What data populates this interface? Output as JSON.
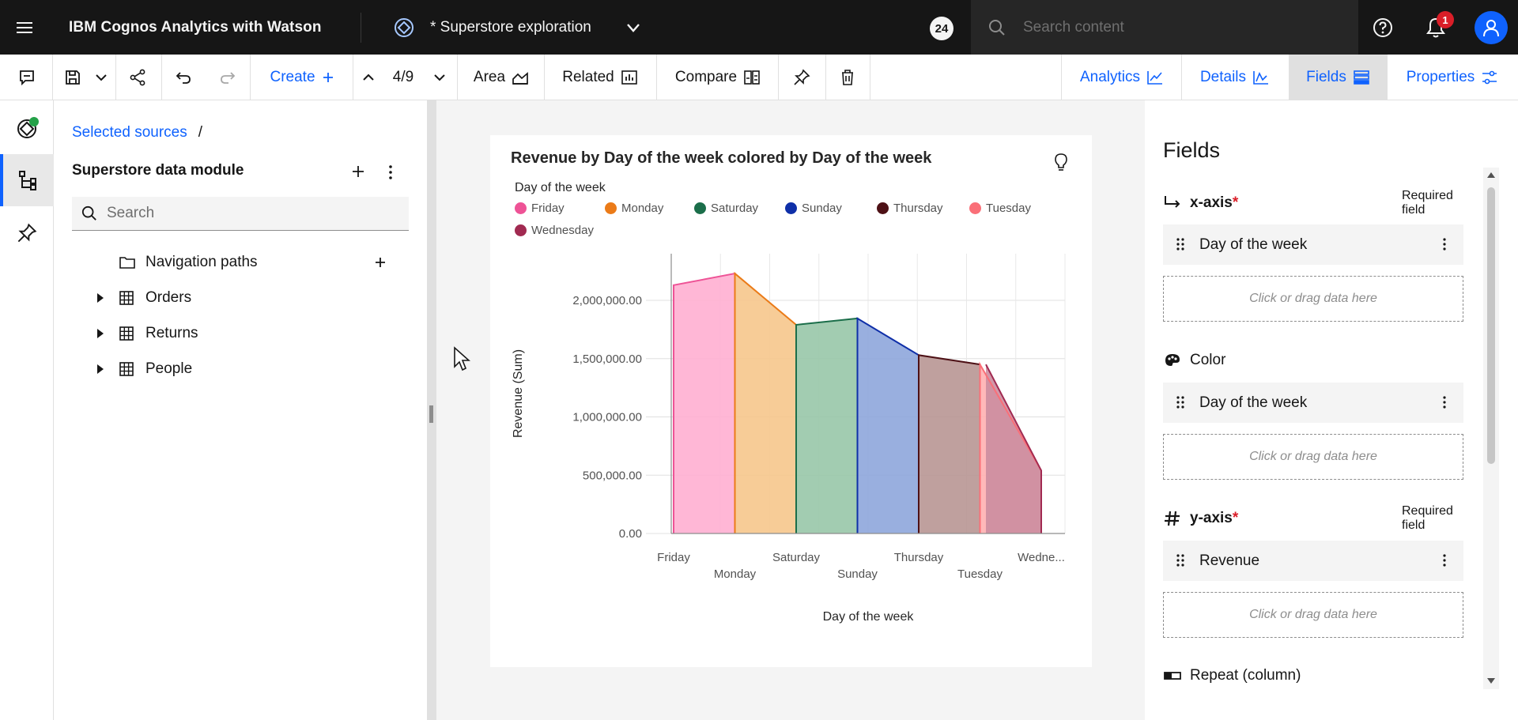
{
  "topbar": {
    "brand": "IBM Cognos Analytics with Watson",
    "document_title": "* Superstore exploration",
    "badge_count": "24",
    "search_placeholder": "Search content",
    "notification_count": "1"
  },
  "toolbar": {
    "create_label": "Create",
    "page_indicator": "4/9",
    "area_label": "Area",
    "related_label": "Related",
    "compare_label": "Compare",
    "analytics_label": "Analytics",
    "details_label": "Details",
    "fields_label": "Fields",
    "properties_label": "Properties"
  },
  "sources": {
    "breadcrumb": "Selected sources",
    "breadcrumb_sep": "/",
    "module_title": "Superstore data module",
    "search_placeholder": "Search",
    "tree": [
      {
        "label": "Navigation paths",
        "kind": "folder"
      },
      {
        "label": "Orders",
        "kind": "table"
      },
      {
        "label": "Returns",
        "kind": "table"
      },
      {
        "label": "People",
        "kind": "table"
      }
    ]
  },
  "chart_data": {
    "type": "area",
    "title": "Revenue by Day of the week colored by Day of the week",
    "legend_title": "Day of the week",
    "legend_position": "top",
    "categories": [
      "Friday",
      "Monday",
      "Saturday",
      "Sunday",
      "Thursday",
      "Tuesday",
      "Wedne..."
    ],
    "series": [
      {
        "name": "Friday",
        "color": "#ee5396",
        "fill": "#ffafd2"
      },
      {
        "name": "Monday",
        "color": "#eb7b18",
        "fill": "#f6c68c"
      },
      {
        "name": "Saturday",
        "color": "#1b6e4a",
        "fill": "#98c7a8"
      },
      {
        "name": "Sunday",
        "color": "#0f2fa8",
        "fill": "#8ea6dc"
      },
      {
        "name": "Thursday",
        "color": "#4e1116",
        "fill": "#b89693"
      },
      {
        "name": "Tuesday",
        "color": "#fa6f78",
        "fill": "#ffb0b1"
      },
      {
        "name": "Wednesday",
        "color": "#a12a51",
        "fill": "#cc8da0"
      }
    ],
    "values": [
      2130000,
      2230000,
      1790000,
      1845000,
      1530000,
      1450000,
      540000
    ],
    "xlabel": "Day of the week",
    "ylabel": "Revenue (Sum)",
    "ylim": [
      0,
      2400000
    ],
    "yticks": [
      0,
      500000,
      1000000,
      1500000,
      2000000
    ],
    "ytick_labels": [
      "0.00",
      "500,000.00",
      "1,000,000.00",
      "1,500,000.00",
      "2,000,000.00"
    ],
    "grid": true
  },
  "fields": {
    "title": "Fields",
    "sections": [
      {
        "name": "x-axis",
        "required": true,
        "required_label": "Required field",
        "chip": "Day of the week",
        "drop": "Click or drag data here"
      },
      {
        "name": "Color",
        "required": false,
        "chip": "Day of the week",
        "drop": "Click or drag data here"
      },
      {
        "name": "y-axis",
        "required": true,
        "required_label": "Required field",
        "chip": "Revenue",
        "drop": "Click or drag data here"
      },
      {
        "name": "Repeat (column)"
      }
    ],
    "required_star": "*"
  }
}
